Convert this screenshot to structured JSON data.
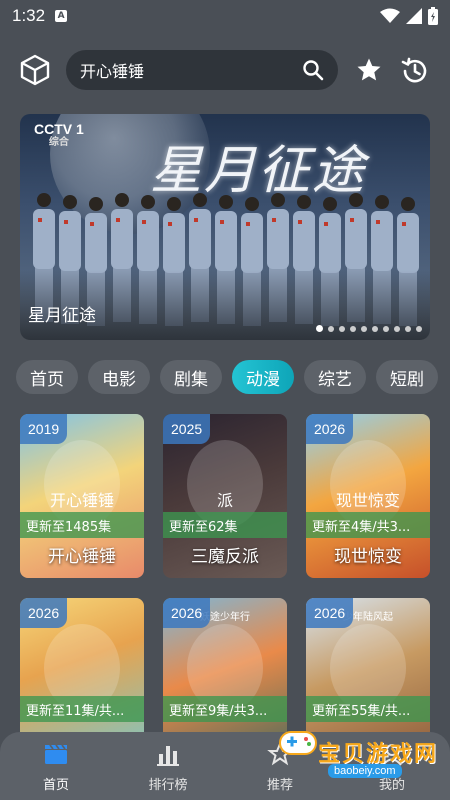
{
  "status": {
    "time": "1:32",
    "notif": "A"
  },
  "search": {
    "query": "开心锤锤"
  },
  "banner": {
    "logo": "CCTV 1",
    "logo_sub": "综合",
    "title_art": "星月征途",
    "caption": "星月征途",
    "dot_count": 10,
    "active_dot": 0
  },
  "tabs": [
    "首页",
    "电影",
    "剧集",
    "动漫",
    "综艺",
    "短剧"
  ],
  "active_tab": "动漫",
  "cards": [
    {
      "year": "2019",
      "update": "更新至1485集",
      "name": "开心锤锤",
      "art_text": "开心锤锤"
    },
    {
      "year": "2025",
      "update": "更新至62集",
      "name": "三魔反派",
      "art_text": "派"
    },
    {
      "year": "2026",
      "update": "更新至4集/共3...",
      "name": "现世惊变",
      "art_text": "现世惊变"
    },
    {
      "year": "2026",
      "update": "更新至11集/共...",
      "name": "",
      "art_text": ""
    },
    {
      "year": "2026",
      "update": "更新至9集/共3...",
      "name": "",
      "art_text": "妖途少年行"
    },
    {
      "year": "2026",
      "update": "更新至55集/共...",
      "name": "",
      "art_text": "少年陆风起"
    }
  ],
  "nav": [
    {
      "label": "首页",
      "icon": "clapperboard-icon",
      "active": true
    },
    {
      "label": "排行榜",
      "icon": "bar-chart-icon",
      "active": false
    },
    {
      "label": "推荐",
      "icon": "recommend-icon",
      "active": false
    },
    {
      "label": "我的",
      "icon": "user-icon",
      "active": false
    }
  ],
  "watermark": {
    "text": "宝贝游戏网",
    "url": "baobeiy.com"
  },
  "colors": {
    "accent": "#15b3c5",
    "background": "#4a4f56",
    "nav_active": "#2f8cf0"
  }
}
